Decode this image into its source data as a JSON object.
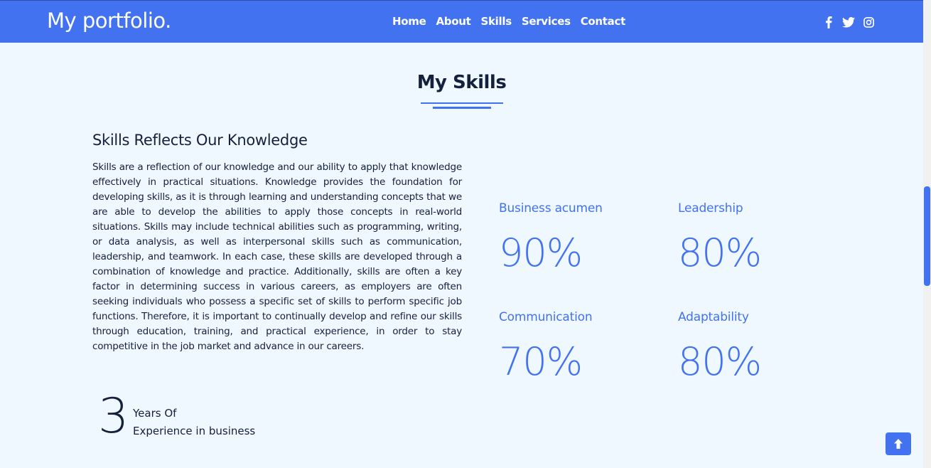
{
  "navbar": {
    "brand": "My portfolio.",
    "links": [
      "Home",
      "About",
      "Skills",
      "Services",
      "Contact"
    ],
    "social_icons": [
      "facebook-icon",
      "twitter-icon",
      "instagram-icon"
    ]
  },
  "section": {
    "title": "My Skills",
    "subtitle": "Skills Reflects Our Knowledge",
    "paragraph": "Skills are a reflection of our knowledge and our ability to apply that knowledge effectively in practical situations. Knowledge provides the foundation for developing skills, as it is through learning and understanding concepts that we are able to develop the abilities to apply those concepts in real-world situations. Skills may include technical abilities such as programming, writing, or data analysis, as well as interpersonal skills such as communication, leadership, and teamwork. In each case, these skills are developed through a combination of knowledge and practice. Additionally, skills are often a key factor in determining success in various careers, as employers are often seeking individuals who possess a specific set of skills to perform specific job functions. Therefore, it is important to continually develop and refine our skills through education, training, and practical experience, in order to stay competitive in the job market and advance in our careers.",
    "experience": {
      "number": "3",
      "line1": "Years Of",
      "line2": "Experience in business"
    },
    "skills": [
      {
        "name": "Business acumen",
        "value": "90%"
      },
      {
        "name": "Leadership",
        "value": "80%"
      },
      {
        "name": "Communication",
        "value": "70%"
      },
      {
        "name": "Adaptability",
        "value": "80%"
      }
    ]
  },
  "colors": {
    "accent": "#4272f0",
    "background": "#eff7ff",
    "text": "#14213d"
  }
}
